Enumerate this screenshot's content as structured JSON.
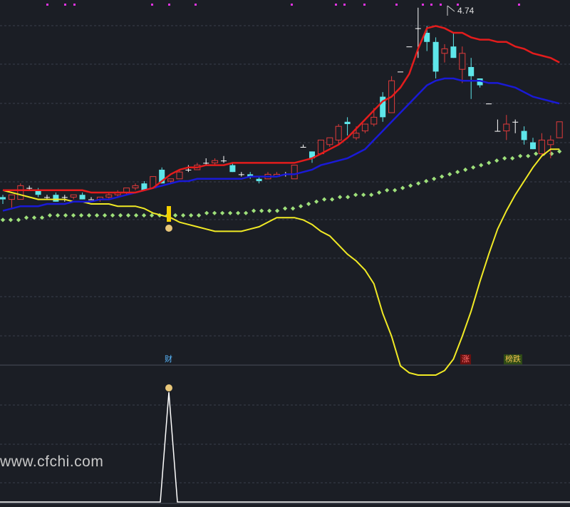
{
  "chart_data": {
    "type": "candlestick",
    "peak_label": "4.74",
    "markers": {
      "cai": "财",
      "zhang": "涨",
      "bang_die": "榜跌"
    },
    "watermark": "www.cfchi.com",
    "colors": {
      "up": "#e03b3b",
      "down": "#5ee6ea",
      "doji": "#ffffff",
      "red_line": "#e41c1c",
      "blue_line": "#1a1ad6",
      "yellow_line": "#f1ea25",
      "green_dots": "#9ee07a",
      "magenta_dots": "#e233e2",
      "background": "#1b1e25"
    },
    "price_axis": {
      "min": 0,
      "max": 100
    },
    "candles": [
      {
        "o": 23,
        "h": 24,
        "l": 20,
        "c": 22
      },
      {
        "o": 22,
        "h": 24,
        "l": 18,
        "c": 24
      },
      {
        "o": 22,
        "h": 29,
        "l": 22,
        "c": 28
      },
      {
        "o": 27,
        "h": 28,
        "l": 26,
        "c": 27
      },
      {
        "o": 26,
        "h": 27,
        "l": 23,
        "c": 24
      },
      {
        "o": 23,
        "h": 24,
        "l": 22,
        "c": 23
      },
      {
        "o": 24,
        "h": 25,
        "l": 21,
        "c": 21
      },
      {
        "o": 23,
        "h": 24,
        "l": 21,
        "c": 23
      },
      {
        "o": 23,
        "h": 24,
        "l": 22,
        "c": 24
      },
      {
        "o": 24,
        "h": 25,
        "l": 22,
        "c": 22
      },
      {
        "o": 22,
        "h": 23,
        "l": 22,
        "c": 22
      },
      {
        "o": 22,
        "h": 23,
        "l": 21,
        "c": 23
      },
      {
        "o": 23,
        "h": 25,
        "l": 22,
        "c": 24
      },
      {
        "o": 24,
        "h": 26,
        "l": 23,
        "c": 25
      },
      {
        "o": 25,
        "h": 27,
        "l": 24,
        "c": 27
      },
      {
        "o": 27,
        "h": 29,
        "l": 26,
        "c": 28
      },
      {
        "o": 29,
        "h": 30,
        "l": 26,
        "c": 26
      },
      {
        "o": 27,
        "h": 32,
        "l": 27,
        "c": 32
      },
      {
        "o": 35,
        "h": 36,
        "l": 29,
        "c": 29
      },
      {
        "o": 30,
        "h": 31,
        "l": 29,
        "c": 31
      },
      {
        "o": 31,
        "h": 35,
        "l": 31,
        "c": 34
      },
      {
        "o": 35,
        "h": 37,
        "l": 34,
        "c": 35
      },
      {
        "o": 35,
        "h": 38,
        "l": 35,
        "c": 37
      },
      {
        "o": 38,
        "h": 40,
        "l": 37,
        "c": 38
      },
      {
        "o": 38,
        "h": 40,
        "l": 37,
        "c": 39
      },
      {
        "o": 39,
        "h": 41,
        "l": 38,
        "c": 39
      },
      {
        "o": 37,
        "h": 38,
        "l": 34,
        "c": 34
      },
      {
        "o": 33,
        "h": 34,
        "l": 32,
        "c": 33
      },
      {
        "o": 33,
        "h": 34,
        "l": 31,
        "c": 32
      },
      {
        "o": 31,
        "h": 32,
        "l": 29,
        "c": 30
      },
      {
        "o": 31,
        "h": 34,
        "l": 31,
        "c": 33
      },
      {
        "o": 32,
        "h": 34,
        "l": 32,
        "c": 33
      },
      {
        "o": 33,
        "h": 34,
        "l": 32,
        "c": 33
      },
      {
        "o": 31,
        "h": 37,
        "l": 31,
        "c": 37
      },
      {
        "o": 45,
        "h": 46,
        "l": 45,
        "c": 45
      },
      {
        "o": 43,
        "h": 43,
        "l": 38,
        "c": 40
      },
      {
        "o": 42,
        "h": 48,
        "l": 42,
        "c": 48
      },
      {
        "o": 46,
        "h": 49,
        "l": 45,
        "c": 49
      },
      {
        "o": 48,
        "h": 55,
        "l": 46,
        "c": 54
      },
      {
        "o": 56,
        "h": 58,
        "l": 50,
        "c": 55
      },
      {
        "o": 49,
        "h": 54,
        "l": 48,
        "c": 51
      },
      {
        "o": 52,
        "h": 55,
        "l": 51,
        "c": 55
      },
      {
        "o": 55,
        "h": 62,
        "l": 54,
        "c": 58
      },
      {
        "o": 67,
        "h": 69,
        "l": 56,
        "c": 58
      },
      {
        "o": 60,
        "h": 76,
        "l": 60,
        "c": 74
      },
      {
        "o": 78,
        "h": 78,
        "l": 78,
        "c": 78
      },
      {
        "o": 89,
        "h": 89,
        "l": 89,
        "c": 89
      },
      {
        "o": 97,
        "h": 106,
        "l": 84,
        "c": 97
      },
      {
        "o": 95,
        "h": 98,
        "l": 87,
        "c": 91
      },
      {
        "o": 91,
        "h": 93,
        "l": 75,
        "c": 78
      },
      {
        "o": 86,
        "h": 90,
        "l": 82,
        "c": 88
      },
      {
        "o": 89,
        "h": 95,
        "l": 84,
        "c": 84
      },
      {
        "o": 79,
        "h": 89,
        "l": 73,
        "c": 86
      },
      {
        "o": 80,
        "h": 84,
        "l": 66,
        "c": 76
      },
      {
        "o": 75,
        "h": 75,
        "l": 71,
        "c": 72
      },
      {
        "o": 64,
        "h": 64,
        "l": 64,
        "c": 64
      },
      {
        "o": 52,
        "h": 57,
        "l": 52,
        "c": 52
      },
      {
        "o": 52,
        "h": 59,
        "l": 48,
        "c": 55
      },
      {
        "o": 56,
        "h": 57,
        "l": 51,
        "c": 56
      },
      {
        "o": 52,
        "h": 54,
        "l": 46,
        "c": 48
      },
      {
        "o": 47,
        "h": 49,
        "l": 44,
        "c": 44
      },
      {
        "o": 42,
        "h": 51,
        "l": 41,
        "c": 48
      },
      {
        "o": 46,
        "h": 50,
        "l": 40,
        "c": 48
      },
      {
        "o": 49,
        "h": 56,
        "l": 49,
        "c": 56
      }
    ],
    "red_line": [
      26,
      26,
      26,
      26,
      26,
      26,
      26,
      26,
      26,
      26,
      25,
      25,
      25,
      25,
      25,
      25,
      26,
      27,
      30,
      33,
      35,
      36,
      36,
      37,
      37,
      37,
      38,
      38,
      38,
      38,
      38,
      38,
      38,
      38,
      39,
      40,
      42,
      44,
      46,
      49,
      53,
      57,
      61,
      65,
      67,
      71,
      77,
      88,
      97,
      98,
      97,
      95,
      95,
      93,
      92,
      92,
      91,
      91,
      89,
      88,
      86,
      85,
      84,
      82
    ],
    "blue_line": [
      17,
      18,
      19,
      19,
      19,
      20,
      20,
      20,
      21,
      21,
      21,
      22,
      22,
      23,
      24,
      25,
      26,
      27,
      28,
      29,
      30,
      30,
      31,
      31,
      31,
      31,
      31,
      31,
      32,
      32,
      32,
      32,
      33,
      33,
      34,
      35,
      37,
      38,
      39,
      40,
      42,
      44,
      48,
      52,
      56,
      60,
      64,
      68,
      72,
      74,
      75,
      75,
      74,
      74,
      74,
      73,
      73,
      72,
      71,
      69,
      67,
      66,
      65,
      64
    ],
    "yellow_line": [
      26,
      25,
      24,
      23,
      22,
      22,
      22,
      22,
      21,
      21,
      20,
      20,
      20,
      19,
      19,
      19,
      18,
      16,
      15,
      14,
      12,
      11,
      10,
      9,
      8,
      8,
      8,
      8,
      9,
      10,
      12,
      14,
      14,
      14,
      13,
      11,
      8,
      6,
      2,
      -2,
      -5,
      -9,
      -15,
      -28,
      -38,
      -51,
      -54,
      -55,
      -55,
      -55,
      -53,
      -48,
      -38,
      -27,
      -14,
      -2,
      9,
      17,
      24,
      30,
      36,
      41,
      44,
      44
    ],
    "green_dots": [
      13,
      13,
      13,
      14,
      14,
      14,
      15,
      15,
      15,
      15,
      15,
      15,
      15,
      15,
      15,
      15,
      15,
      15,
      15,
      15,
      15,
      15,
      15,
      15,
      15,
      15,
      16,
      16,
      16,
      16,
      16,
      16,
      17,
      17,
      17,
      17,
      18,
      18,
      19,
      20,
      21,
      22,
      22,
      23,
      23,
      24,
      24,
      24,
      25,
      26,
      26,
      27,
      28,
      29,
      30,
      31,
      32,
      33,
      34,
      35,
      36,
      37,
      38,
      39,
      40,
      40,
      41,
      41,
      42,
      42,
      42,
      43
    ],
    "lower_panel": {
      "spike_index": 18,
      "spike_value": 100
    }
  }
}
